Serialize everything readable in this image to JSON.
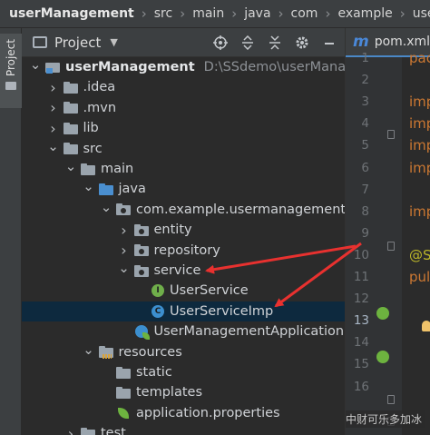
{
  "breadcrumb": [
    "userManagement",
    "src",
    "main",
    "java",
    "com",
    "example",
    "usermanage"
  ],
  "left_strip": {
    "project_tab": "Project"
  },
  "panel": {
    "title": "Project",
    "header_icons": [
      "crosshair-icon",
      "expand-all-icon",
      "collapse-all-icon",
      "gear-icon",
      "minimize-icon"
    ]
  },
  "tree": [
    {
      "label": "userManagement",
      "path": "D:\\SSdemo\\userManageme",
      "indent": 0,
      "arrow": "down",
      "icon": "module",
      "bold": true
    },
    {
      "label": ".idea",
      "indent": 1,
      "arrow": "right",
      "icon": "folder-gray"
    },
    {
      "label": ".mvn",
      "indent": 1,
      "arrow": "right",
      "icon": "folder-gray"
    },
    {
      "label": "lib",
      "indent": 1,
      "arrow": "right",
      "icon": "folder-gray"
    },
    {
      "label": "src",
      "indent": 1,
      "arrow": "down",
      "icon": "folder-gray"
    },
    {
      "label": "main",
      "indent": 2,
      "arrow": "down",
      "icon": "folder-gray"
    },
    {
      "label": "java",
      "indent": 3,
      "arrow": "down",
      "icon": "folder-blue"
    },
    {
      "label": "com.example.usermanagement",
      "indent": 4,
      "arrow": "down",
      "icon": "package"
    },
    {
      "label": "entity",
      "indent": 5,
      "arrow": "right",
      "icon": "package"
    },
    {
      "label": "repository",
      "indent": 5,
      "arrow": "right",
      "icon": "package"
    },
    {
      "label": "service",
      "indent": 5,
      "arrow": "down",
      "icon": "package"
    },
    {
      "label": "UserService",
      "indent": 6,
      "arrow": "none",
      "icon": "interface"
    },
    {
      "label": "UserServiceImp",
      "indent": 6,
      "arrow": "none",
      "icon": "class",
      "selected": true
    },
    {
      "label": "UserManagementApplication",
      "indent": 5,
      "arrow": "none",
      "icon": "app"
    },
    {
      "label": "resources",
      "indent": 3,
      "arrow": "down",
      "icon": "resources"
    },
    {
      "label": "static",
      "indent": 4,
      "arrow": "none",
      "icon": "folder-gray"
    },
    {
      "label": "templates",
      "indent": 4,
      "arrow": "none",
      "icon": "folder-gray"
    },
    {
      "label": "application.properties",
      "indent": 4,
      "arrow": "none",
      "icon": "properties"
    },
    {
      "label": "test",
      "indent": 2,
      "arrow": "right",
      "icon": "folder-gray"
    }
  ],
  "editor": {
    "tab_label": "pom.xml",
    "tab_icon_letter": "m",
    "lines": [
      {
        "n": "1",
        "code": "pac"
      },
      {
        "n": "2",
        "code": ""
      },
      {
        "n": "3",
        "code": "imp"
      },
      {
        "n": "4",
        "code": "imp"
      },
      {
        "n": "5",
        "code": "imp"
      },
      {
        "n": "6",
        "code": "imp"
      },
      {
        "n": "7",
        "code": ""
      },
      {
        "n": "8",
        "code": "imp"
      },
      {
        "n": "9",
        "code": ""
      },
      {
        "n": "10",
        "code": "@Se"
      },
      {
        "n": "11",
        "code": "pul"
      },
      {
        "n": "12",
        "code": ""
      },
      {
        "n": "13",
        "code": ""
      },
      {
        "n": "14",
        "code": ""
      },
      {
        "n": "15",
        "code": ""
      },
      {
        "n": "16",
        "code": ""
      }
    ]
  },
  "watermark": "CSDN @中财可乐多加冰"
}
